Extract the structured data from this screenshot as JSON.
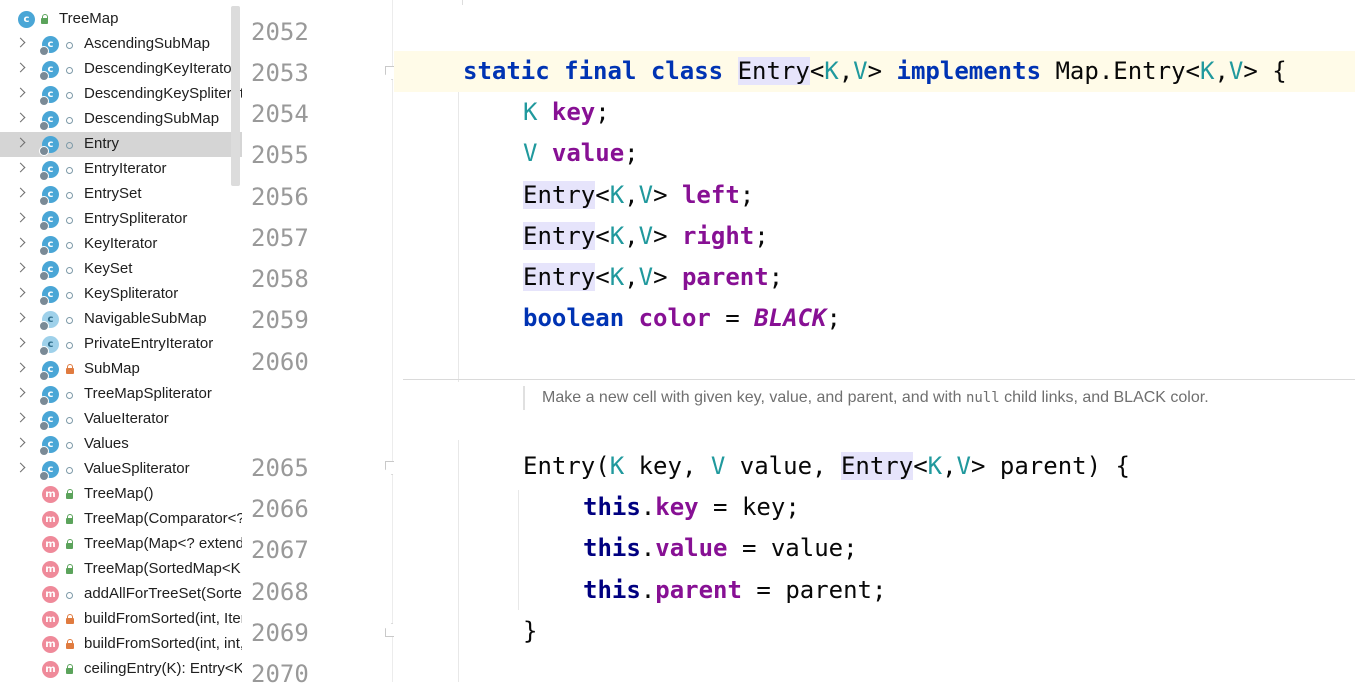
{
  "structure": {
    "items": [
      {
        "label": "TreeMap",
        "kind": "class",
        "visibility": "public",
        "level": 0,
        "expandable": false,
        "root": true
      },
      {
        "label": "AscendingSubMap",
        "kind": "class",
        "visibility": "package",
        "level": 1,
        "expandable": true
      },
      {
        "label": "DescendingKeyIterator",
        "kind": "class",
        "visibility": "package",
        "level": 1,
        "expandable": true
      },
      {
        "label": "DescendingKeySpliterator",
        "kind": "class",
        "visibility": "package",
        "level": 1,
        "expandable": true
      },
      {
        "label": "DescendingSubMap",
        "kind": "class",
        "visibility": "package",
        "level": 1,
        "expandable": true
      },
      {
        "label": "Entry",
        "kind": "class",
        "visibility": "package",
        "level": 1,
        "expandable": true,
        "selected": true
      },
      {
        "label": "EntryIterator",
        "kind": "class",
        "visibility": "package",
        "level": 1,
        "expandable": true
      },
      {
        "label": "EntrySet",
        "kind": "class",
        "visibility": "package",
        "level": 1,
        "expandable": true
      },
      {
        "label": "EntrySpliterator",
        "kind": "class",
        "visibility": "package",
        "level": 1,
        "expandable": true
      },
      {
        "label": "KeyIterator",
        "kind": "class",
        "visibility": "package",
        "level": 1,
        "expandable": true
      },
      {
        "label": "KeySet",
        "kind": "class",
        "visibility": "package",
        "level": 1,
        "expandable": true
      },
      {
        "label": "KeySpliterator",
        "kind": "class",
        "visibility": "package",
        "level": 1,
        "expandable": true
      },
      {
        "label": "NavigableSubMap",
        "kind": "abstract-class",
        "visibility": "package",
        "level": 1,
        "expandable": true
      },
      {
        "label": "PrivateEntryIterator",
        "kind": "abstract-class",
        "visibility": "package",
        "level": 1,
        "expandable": true
      },
      {
        "label": "SubMap",
        "kind": "class",
        "visibility": "private",
        "level": 1,
        "expandable": true
      },
      {
        "label": "TreeMapSpliterator",
        "kind": "class",
        "visibility": "package",
        "level": 1,
        "expandable": true
      },
      {
        "label": "ValueIterator",
        "kind": "class",
        "visibility": "package",
        "level": 1,
        "expandable": true
      },
      {
        "label": "Values",
        "kind": "class",
        "visibility": "package",
        "level": 1,
        "expandable": true
      },
      {
        "label": "ValueSpliterator",
        "kind": "class",
        "visibility": "package",
        "level": 1,
        "expandable": true
      },
      {
        "label": "TreeMap()",
        "kind": "method",
        "visibility": "public",
        "level": 1,
        "expandable": false
      },
      {
        "label": "TreeMap(Comparator<? super K>)",
        "kind": "method",
        "visibility": "public",
        "level": 1,
        "expandable": false
      },
      {
        "label": "TreeMap(Map<? extends K, ? extends V>)",
        "kind": "method",
        "visibility": "public",
        "level": 1,
        "expandable": false
      },
      {
        "label": "TreeMap(SortedMap<K, ? extends V>)",
        "kind": "method",
        "visibility": "public",
        "level": 1,
        "expandable": false
      },
      {
        "label": "addAllForTreeSet(SortedSet<? extends K>, V)",
        "kind": "method",
        "visibility": "package",
        "level": 1,
        "expandable": false
      },
      {
        "label": "buildFromSorted(int, Iterator<?>, ObjectInputStream, V)",
        "kind": "method",
        "visibility": "private",
        "level": 1,
        "expandable": false
      },
      {
        "label": "buildFromSorted(int, int, int, int, Iterator<?>, ObjectInputStream, V)",
        "kind": "method",
        "visibility": "private",
        "level": 1,
        "expandable": false
      },
      {
        "label": "ceilingEntry(K): Entry<K, V>",
        "kind": "method",
        "visibility": "public",
        "level": 1,
        "expandable": false
      }
    ]
  },
  "editor": {
    "current_line": "2053",
    "line_numbers": [
      "2052",
      "2053",
      "2054",
      "2055",
      "2056",
      "2057",
      "2058",
      "2059",
      "2060",
      "2065",
      "2066",
      "2067",
      "2068",
      "2069",
      "2070"
    ],
    "doc_comment": {
      "text_before": "Make a new cell with given key, value, and parent, and with ",
      "code": "null",
      "text_after": " child links, and BLACK color."
    },
    "tokens": {
      "static": "static",
      "final": "final",
      "class": "class",
      "implements": "implements",
      "boolean": "boolean",
      "this": "this",
      "Entry": "Entry",
      "MapEntry": "Map.Entry",
      "K": "K",
      "V": "V",
      "key": "key",
      "value": "value",
      "left": "left",
      "right": "right",
      "parent": "parent",
      "color": "color",
      "BLACK": "BLACK"
    }
  },
  "colors": {
    "keyword": "#0033b3",
    "type_param": "#20999d",
    "field": "#871094",
    "current_line_bg": "#fffbe8",
    "usage_highlight": "#e6e4fb"
  }
}
